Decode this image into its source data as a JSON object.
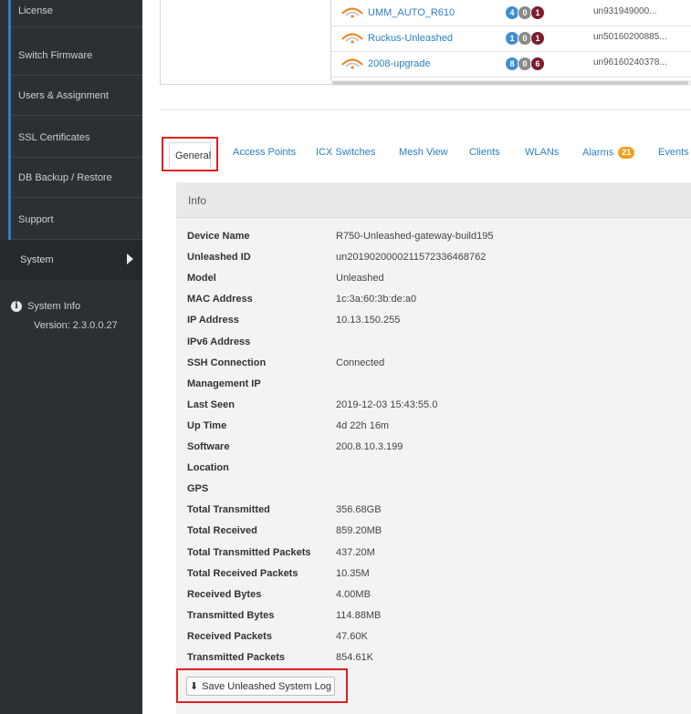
{
  "sidebar": {
    "items": [
      {
        "label": "License"
      },
      {
        "label": "Switch Firmware"
      },
      {
        "label": "Users & Assignment"
      },
      {
        "label": "SSL Certificates"
      },
      {
        "label": "DB Backup / Restore"
      },
      {
        "label": "Support"
      }
    ],
    "system_label": "System",
    "system_info_label": "System Info",
    "version_label": "Version: 2.3.0.0.27"
  },
  "ap_list": [
    {
      "name": "UMM_AUTO_R610",
      "counts": [
        "4",
        "0",
        "1"
      ],
      "serial": "un931949000..."
    },
    {
      "name": "Ruckus-Unleashed",
      "counts": [
        "1",
        "0",
        "1"
      ],
      "serial": "un50160200885..."
    },
    {
      "name": "2008-upgrade",
      "counts": [
        "8",
        "0",
        "6"
      ],
      "serial": "un96160240378..."
    }
  ],
  "tabs": {
    "general": "General",
    "access_points": "Access Points",
    "icx_switches": "ICX Switches",
    "mesh_view": "Mesh View",
    "clients": "Clients",
    "wlans": "WLANs",
    "alarms": "Alarms",
    "alarms_count": "21",
    "events": "Events"
  },
  "info": {
    "header": "Info",
    "rows": [
      {
        "key": "Device Name",
        "value": "R750-Unleashed-gateway-build195"
      },
      {
        "key": "Unleashed ID",
        "value": "un2019020000211572336468762"
      },
      {
        "key": "Model",
        "value": "Unleashed"
      },
      {
        "key": "MAC Address",
        "value": "1c:3a:60:3b:de:a0"
      },
      {
        "key": "IP Address",
        "value": "10.13.150.255"
      },
      {
        "key": "IPv6 Address",
        "value": ""
      },
      {
        "key": "SSH Connection",
        "value": "Connected"
      },
      {
        "key": "Management IP",
        "value": ""
      },
      {
        "key": "Last Seen",
        "value": "2019-12-03 15:43:55.0"
      },
      {
        "key": "Up Time",
        "value": "4d 22h 16m"
      },
      {
        "key": "Software",
        "value": "200.8.10.3.199"
      },
      {
        "key": "Location",
        "value": ""
      },
      {
        "key": "GPS",
        "value": ""
      },
      {
        "key": "Total Transmitted",
        "value": "356.68GB"
      },
      {
        "key": "Total Received",
        "value": "859.20MB"
      },
      {
        "key": "Total Transmitted Packets",
        "value": "437.20M"
      },
      {
        "key": "Total Received Packets",
        "value": "10.35M"
      },
      {
        "key": "Received Bytes",
        "value": "4.00MB"
      },
      {
        "key": "Transmitted Bytes",
        "value": "114.88MB"
      },
      {
        "key": "Received Packets",
        "value": "47.60K"
      },
      {
        "key": "Transmitted Packets",
        "value": "854.61K"
      }
    ]
  },
  "save_button_label": "Save Unleashed System Log",
  "colors": {
    "sidebar_bg": "#2c3034",
    "accent": "#2b7fc3",
    "highlight": "#e02020",
    "alarm": "#f0a020"
  }
}
